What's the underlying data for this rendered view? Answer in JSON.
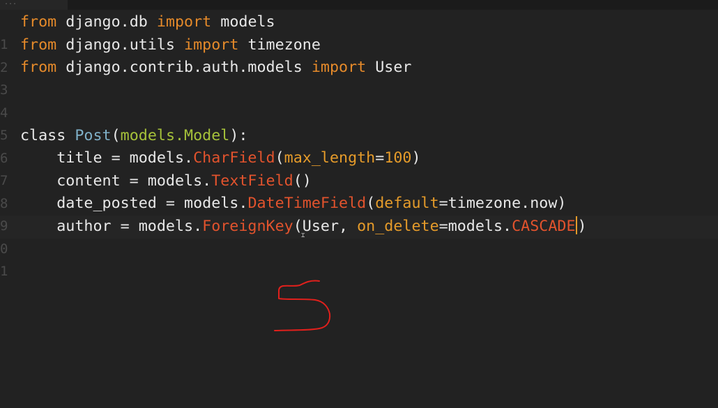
{
  "tab": {
    "label": "..."
  },
  "gutter": [
    "1",
    "2",
    "3",
    "4",
    "5",
    "6",
    "7",
    "8",
    "9",
    "0",
    "1"
  ],
  "code": {
    "line1": {
      "from": "from",
      "mod": " django.db ",
      "import": "import",
      "name": " models"
    },
    "line2": {
      "from": "from",
      "mod": " django.utils ",
      "import": "import",
      "name": " timezone"
    },
    "line3": {
      "from": "from",
      "mod": " django.contrib.auth.models ",
      "import": "import",
      "name": " User"
    },
    "line6": {
      "class": "class",
      "sp": " ",
      "cls": "Post",
      "p1": "(",
      "base": "models.Model",
      "p2": "):"
    },
    "line7": {
      "a": "    title = models.",
      "field": "CharField",
      "p1": "(",
      "kw": "max_length",
      "eq": "=",
      "num": "100",
      "p2": ")"
    },
    "line8": {
      "a": "    content = models.",
      "field": "TextField",
      "p": "()"
    },
    "line9": {
      "a": "    date_posted = models.",
      "field": "DateTimeField",
      "p1": "(",
      "kw": "default",
      "b": "=timezone.now)"
    },
    "line10": {
      "a": "    author = models.",
      "field": "ForeignKey",
      "b": "(User, ",
      "kw": "on_delete",
      "c": "=models.",
      "cascade": "CASCADE",
      "d": ")"
    }
  },
  "colors": {
    "background": "#222222",
    "import_keyword": "#e58a2a",
    "class_name": "#7fb0c8",
    "base_class": "#a6c23a",
    "field_type": "#e2532d",
    "kwarg": "#e59b2a",
    "text": "#e8e8e8",
    "annotation_stroke": "#e0201c"
  },
  "annotation": {
    "description_icon": "handwritten-s-scribble"
  }
}
